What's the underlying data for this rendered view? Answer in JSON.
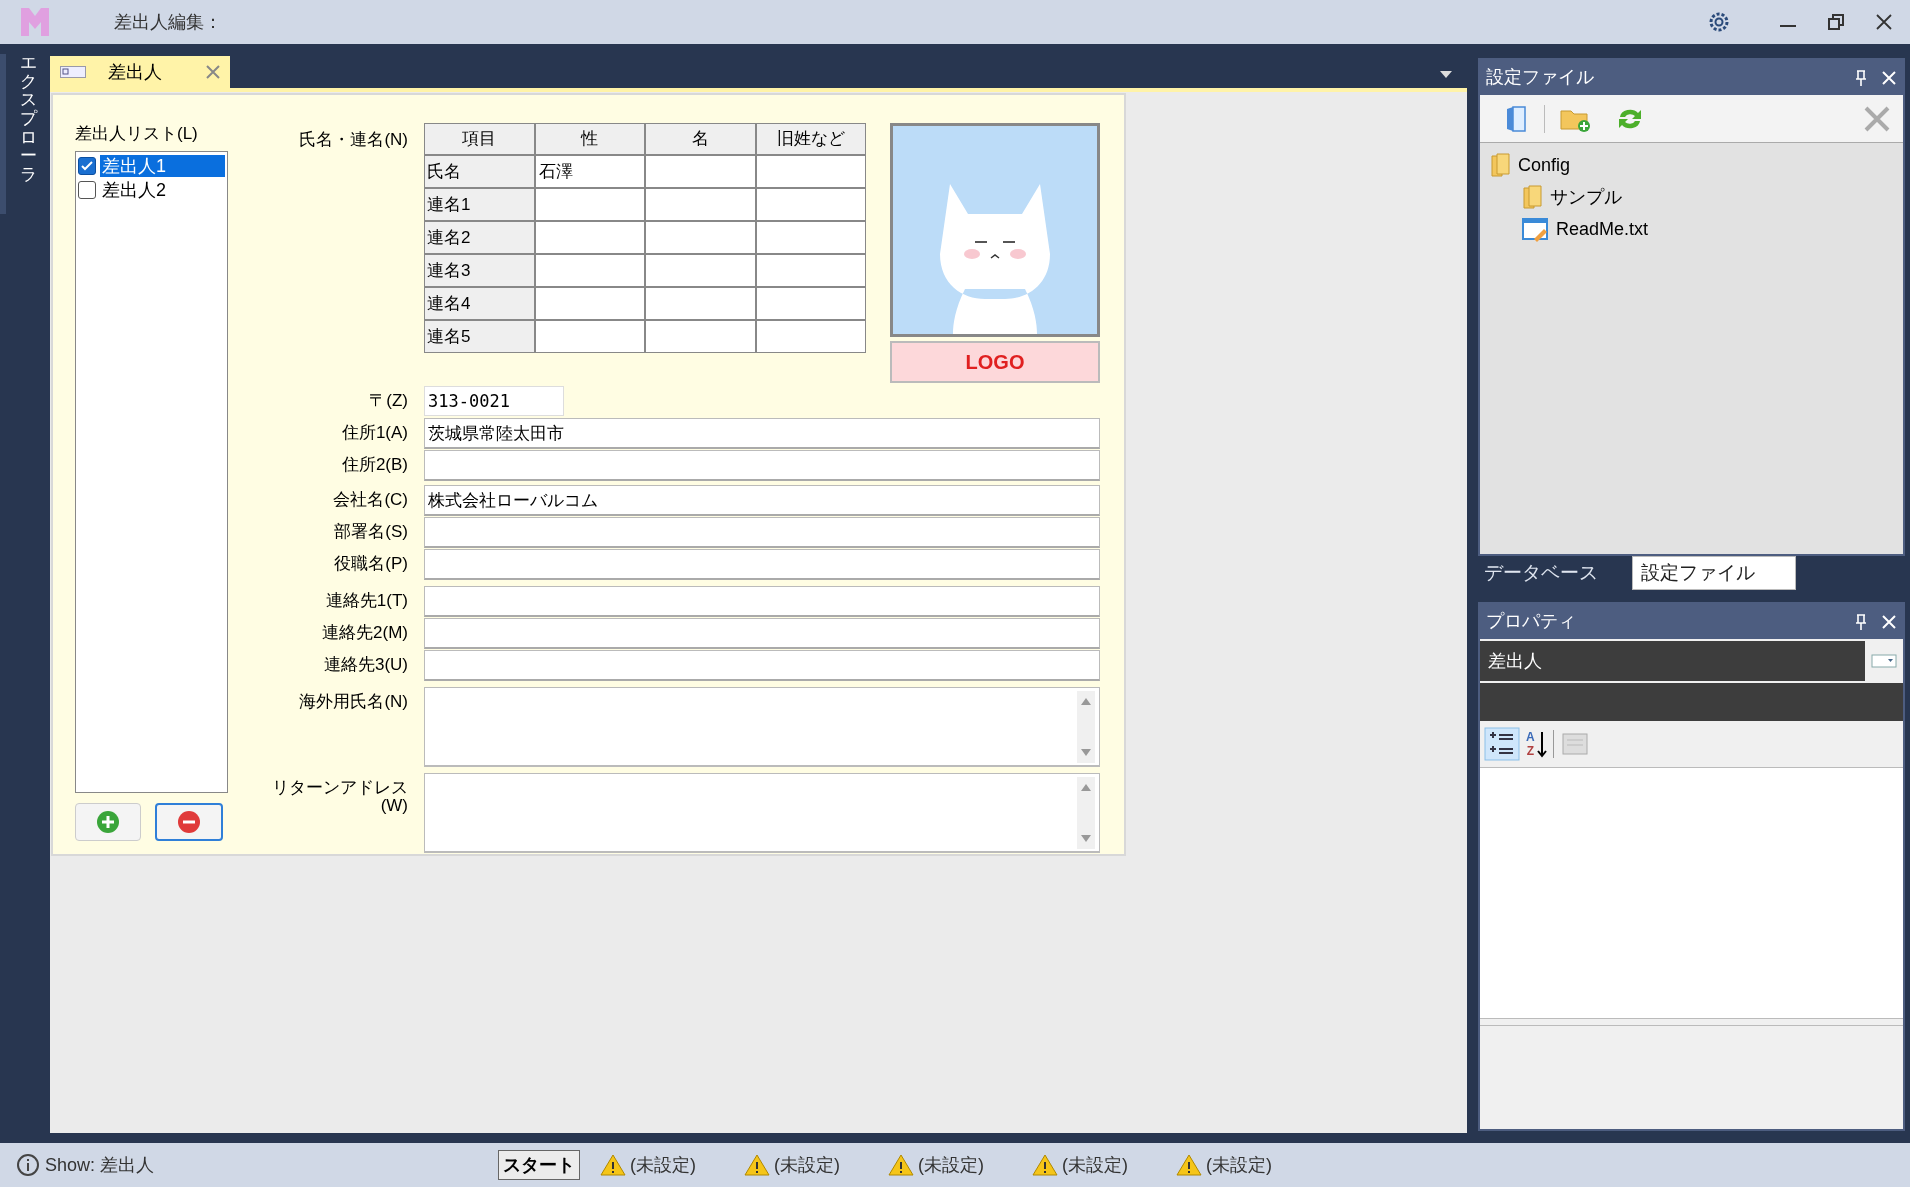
{
  "window": {
    "title": "差出人編集："
  },
  "explorer_label": "エクスプローラ",
  "document_tabs": [
    {
      "label": "差出人",
      "selected": true
    }
  ],
  "sender_list": {
    "label": "差出人リスト(L)",
    "items": [
      {
        "label": "差出人1",
        "checked": true,
        "selected": true
      },
      {
        "label": "差出人2",
        "checked": false,
        "selected": false
      }
    ]
  },
  "name_grid": {
    "label": "氏名・連名(N)",
    "columns": [
      "項目",
      "性",
      "名",
      "旧姓など"
    ],
    "rows": [
      {
        "item": "氏名",
        "cells": [
          "石澤",
          "",
          ""
        ]
      },
      {
        "item": "連名1",
        "cells": [
          "",
          "",
          ""
        ]
      },
      {
        "item": "連名2",
        "cells": [
          "",
          "",
          ""
        ]
      },
      {
        "item": "連名3",
        "cells": [
          "",
          "",
          ""
        ]
      },
      {
        "item": "連名4",
        "cells": [
          "",
          "",
          ""
        ]
      },
      {
        "item": "連名5",
        "cells": [
          "",
          "",
          ""
        ]
      }
    ]
  },
  "logo_label": "LOGO",
  "fields": [
    {
      "label": "〒(Z)",
      "value": "313-0021",
      "kind": "short"
    },
    {
      "label": "住所1(A)",
      "value": "茨城県常陸太田市",
      "kind": "line"
    },
    {
      "label": "住所2(B)",
      "kind": "line"
    },
    {
      "label": "会社名(C)",
      "value": "株式会社ローバルコム",
      "kind": "line"
    },
    {
      "label": "部署名(S)",
      "kind": "line"
    },
    {
      "label": "役職名(P)",
      "kind": "line"
    },
    {
      "label": "連絡先1(T)",
      "kind": "line"
    },
    {
      "label": "連絡先2(M)",
      "kind": "line"
    },
    {
      "label": "連絡先3(U)",
      "kind": "line"
    },
    {
      "label": "海外用氏名(N)",
      "kind": "multiline"
    },
    {
      "label": "リターンアドレス\n(W)",
      "kind": "multiline"
    }
  ],
  "settings_panel": {
    "title": "設定ファイル",
    "tree": [
      {
        "label": "Config",
        "kind": "folder",
        "children": [
          {
            "label": "サンプル",
            "kind": "folder"
          },
          {
            "label": "ReadMe.txt",
            "kind": "file"
          }
        ]
      }
    ]
  },
  "panel_tabs": [
    {
      "label": "データベース",
      "selected": false
    },
    {
      "label": "設定ファイル",
      "selected": true
    }
  ],
  "properties_panel": {
    "title": "プロパティ",
    "object": "差出人",
    "sort_letters": [
      "A",
      "Z"
    ]
  },
  "status_bar": {
    "info": "Show: 差出人",
    "start_button": "スタート",
    "warnings": [
      "(未設定)",
      "(未設定)",
      "(未設定)",
      "(未設定)",
      "(未設定)"
    ]
  }
}
